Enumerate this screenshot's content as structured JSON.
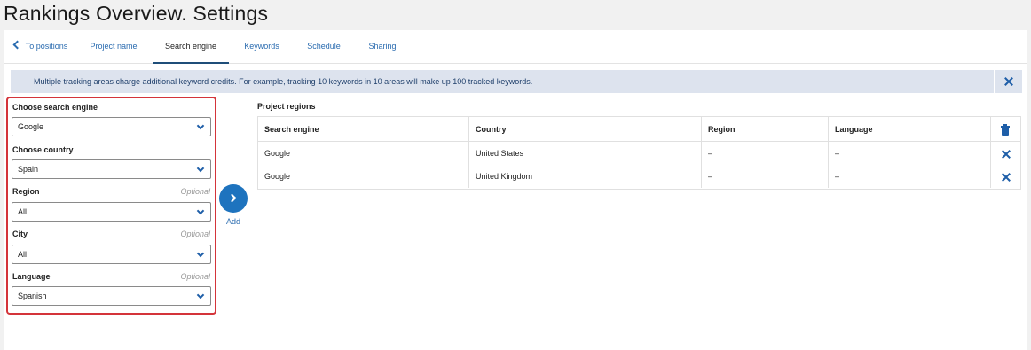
{
  "page": {
    "title": "Rankings Overview. Settings"
  },
  "tabs": {
    "back": "To positions",
    "items": [
      "Project name",
      "Search engine",
      "Keywords",
      "Schedule",
      "Sharing"
    ],
    "active": "Search engine"
  },
  "banner": {
    "text": "Multiple tracking areas charge additional keyword credits. For example, tracking 10 keywords in 10 areas will make up 100 tracked keywords.",
    "close_icon": "close-icon"
  },
  "form": {
    "search_engine": {
      "label": "Choose search engine",
      "value": "Google"
    },
    "country": {
      "label": "Choose country",
      "value": "Spain"
    },
    "region": {
      "label": "Region",
      "optional": "Optional",
      "value": "All"
    },
    "city": {
      "label": "City",
      "optional": "Optional",
      "value": "All"
    },
    "language": {
      "label": "Language",
      "optional": "Optional",
      "value": "Spanish"
    }
  },
  "add": {
    "label": "Add",
    "icon": "chevron-right-icon"
  },
  "regions": {
    "title": "Project regions",
    "columns": [
      "Search engine",
      "Country",
      "Region",
      "Language"
    ],
    "rows": [
      {
        "engine": "Google",
        "country": "United States",
        "region": "–",
        "language": "–"
      },
      {
        "engine": "Google",
        "country": "United Kingdom",
        "region": "–",
        "language": "–"
      }
    ]
  },
  "colors": {
    "accent": "#1e73be",
    "highlight_border": "#d4343a",
    "banner_bg": "#dde3ee"
  }
}
